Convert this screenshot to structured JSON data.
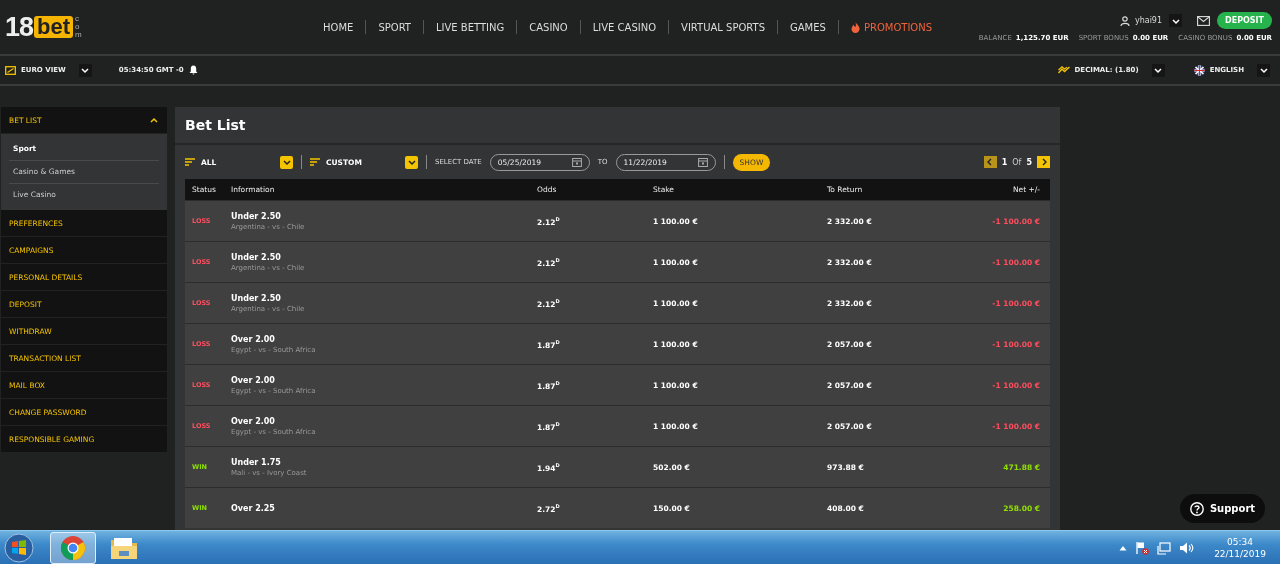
{
  "logo": {
    "digits": "18",
    "word": "bet",
    "suffix": "com"
  },
  "nav": [
    {
      "label": "HOME",
      "kind": "plain"
    },
    {
      "label": "SPORT",
      "kind": "plain"
    },
    {
      "label": "LIVE BETTING",
      "kind": "plain"
    },
    {
      "label": "CASINO",
      "kind": "plain"
    },
    {
      "label": "LIVE CASINO",
      "kind": "plain"
    },
    {
      "label": "VIRTUAL SPORTS",
      "kind": "plain"
    },
    {
      "label": "GAMES",
      "kind": "plain"
    },
    {
      "label": "PROMOTIONS",
      "kind": "promo"
    }
  ],
  "account": {
    "username": "yhai91",
    "deposit": "DEPOSIT",
    "balances": [
      {
        "label": "BALANCE",
        "value": "1,125.70 EUR"
      },
      {
        "label": "SPORT BONUS",
        "value": "0.00 EUR"
      },
      {
        "label": "CASINO BONUS",
        "value": "0.00 EUR"
      }
    ]
  },
  "subbar": {
    "view": "EURO VIEW",
    "clock": "05:34:50 GMT -0",
    "odds_format": "DECIMAL: (1.80)",
    "language": "ENGLISH"
  },
  "sidebar": {
    "items": [
      {
        "label": "BET LIST",
        "expanded": true,
        "children": [
          {
            "label": "Sport",
            "selected": true
          },
          {
            "label": "Casino & Games",
            "selected": false
          },
          {
            "label": "Live Casino",
            "selected": false
          }
        ]
      },
      {
        "label": "PREFERENCES"
      },
      {
        "label": "CAMPAIGNS"
      },
      {
        "label": "PERSONAL DETAILS"
      },
      {
        "label": "DEPOSIT"
      },
      {
        "label": "WITHDRAW"
      },
      {
        "label": "TRANSACTION LIST"
      },
      {
        "label": "MAIL BOX"
      },
      {
        "label": "CHANGE PASSWORD"
      },
      {
        "label": "RESPONSIBLE GAMING"
      }
    ]
  },
  "panel": {
    "title": "Bet List",
    "filters": {
      "type": "ALL",
      "period": "CUSTOM",
      "select_date_label": "SELECT DATE",
      "from": "05/25/2019",
      "to_label": "TO",
      "to": "11/22/2019",
      "show": "SHOW",
      "page": "1",
      "of": "Of",
      "pages": "5"
    },
    "table": {
      "columns": [
        "Status",
        "Information",
        "Odds",
        "Stake",
        "To Return",
        "Net +/-"
      ],
      "rows": [
        {
          "status": "LOSS",
          "kind": "loss",
          "market": "Under 2.50",
          "event": "Argentina - vs - Chile",
          "odds": "2.12$^{D}$",
          "stake": "1 100.00 €",
          "to_return": "2 332.00 €",
          "net": "-1 100.00 €"
        },
        {
          "status": "LOSS",
          "kind": "loss",
          "market": "Under 2.50",
          "event": "Argentina - vs - Chile",
          "odds": "2.12$^{D}$",
          "stake": "1 100.00 €",
          "to_return": "2 332.00 €",
          "net": "-1 100.00 €"
        },
        {
          "status": "LOSS",
          "kind": "loss",
          "market": "Under 2.50",
          "event": "Argentina - vs - Chile",
          "odds": "2.12$^{D}$",
          "stake": "1 100.00 €",
          "to_return": "2 332.00 €",
          "net": "-1 100.00 €"
        },
        {
          "status": "LOSS",
          "kind": "loss",
          "market": "Over 2.00",
          "event": "Egypt - vs - South Africa",
          "odds": "1.87$^{D}$",
          "stake": "1 100.00 €",
          "to_return": "2 057.00 €",
          "net": "-1 100.00 €"
        },
        {
          "status": "LOSS",
          "kind": "loss",
          "market": "Over 2.00",
          "event": "Egypt - vs - South Africa",
          "odds": "1.87$^{D}$",
          "stake": "1 100.00 €",
          "to_return": "2 057.00 €",
          "net": "-1 100.00 €"
        },
        {
          "status": "LOSS",
          "kind": "loss",
          "market": "Over 2.00",
          "event": "Egypt - vs - South Africa",
          "odds": "1.87$^{D}$",
          "stake": "1 100.00 €",
          "to_return": "2 057.00 €",
          "net": "-1 100.00 €"
        },
        {
          "status": "WIN",
          "kind": "win",
          "market": "Under 1.75",
          "event": "Mali - vs - Ivory Coast",
          "odds": "1.94$^{D}$",
          "stake": "502.00 €",
          "to_return": "973.88 €",
          "net": "471.88 €"
        },
        {
          "status": "WIN",
          "kind": "win",
          "market": "Over 2.25",
          "odds": "2.72$^{D}$",
          "stake": "150.00 €",
          "to_return": "408.00 €",
          "net": "258.00 €"
        }
      ]
    }
  },
  "support": "Support",
  "taskbar": {
    "time": "05:34",
    "date": "22/11/2019"
  }
}
